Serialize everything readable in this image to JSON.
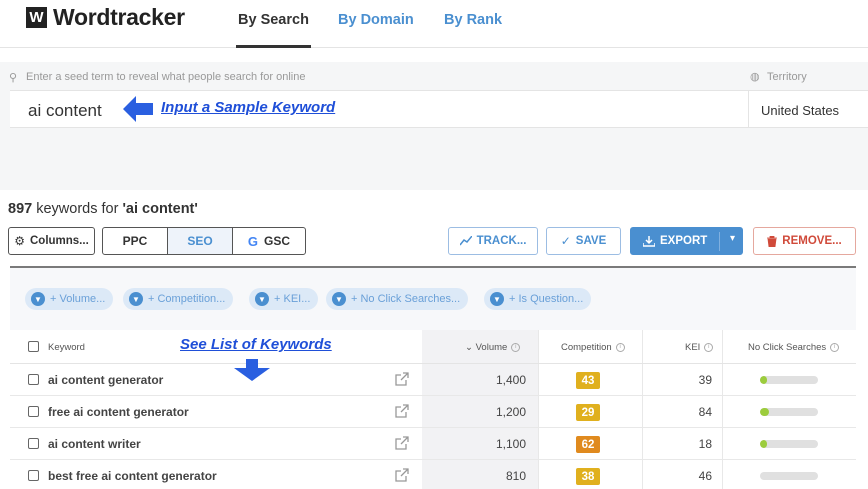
{
  "brand": {
    "logo_mark": "W",
    "name": "Wordtracker"
  },
  "nav": {
    "tabs": [
      {
        "label": "By Search",
        "active": true
      },
      {
        "label": "By Domain",
        "active": false
      },
      {
        "label": "By Rank",
        "active": false
      }
    ]
  },
  "search": {
    "hint": "Enter a seed term to reveal what people search for online",
    "value": "ai content",
    "territory_label": "Territory",
    "territory_value": "United States"
  },
  "annotations": {
    "input_note": "Input a Sample Keyword",
    "list_note": "See List of Keywords"
  },
  "results": {
    "count": "897",
    "suffix": " keywords for ",
    "query": "'ai content'"
  },
  "toolbar": {
    "columns": "Columns...",
    "ppc": "PPC",
    "seo": "SEO",
    "gsc_g": "G",
    "gsc": "GSC",
    "track": "TRACK...",
    "save": "SAVE",
    "export": "EXPORT",
    "remove": "REMOVE..."
  },
  "filters": [
    "+ Volume...",
    "+ Competition...",
    "+ KEI...",
    "+ No Click Searches...",
    "+ Is Question..."
  ],
  "table": {
    "headers": {
      "keyword": "Keyword",
      "volume": "Volume",
      "competition": "Competition",
      "kei": "KEI",
      "no_click": "No Click Searches"
    },
    "rows": [
      {
        "keyword": "ai content generator",
        "volume": "1,400",
        "competition": "43",
        "competition_color": "#e0b01e",
        "kei": "39",
        "no_click_fraction": 0.12
      },
      {
        "keyword": "free ai content generator",
        "volume": "1,200",
        "competition": "29",
        "competition_color": "#e0b01e",
        "kei": "84",
        "no_click_fraction": 0.15
      },
      {
        "keyword": "ai content writer",
        "volume": "1,100",
        "competition": "62",
        "competition_color": "#e08a1e",
        "kei": "18",
        "no_click_fraction": 0.12
      },
      {
        "keyword": "best free ai content generator",
        "volume": "810",
        "competition": "38",
        "competition_color": "#e0b01e",
        "kei": "46",
        "no_click_fraction": 0.0
      }
    ]
  },
  "colors": {
    "accent": "#4a8fd0",
    "annotation": "#1f4fd8",
    "danger": "#d04a3a"
  }
}
